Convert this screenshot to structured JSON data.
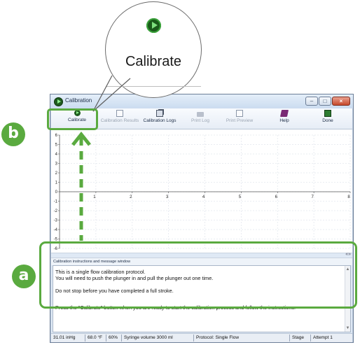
{
  "window": {
    "title": "Calibration",
    "controls": [
      "minimize",
      "maximize",
      "close"
    ]
  },
  "toolbar": {
    "buttons": [
      {
        "label": "Calibrate",
        "icon": "play-circle-icon",
        "enabled": true
      },
      {
        "label": "Calibration Results",
        "icon": "document-icon",
        "enabled": false
      },
      {
        "label": "Calibration Logs",
        "icon": "documents-icon",
        "enabled": true
      },
      {
        "label": "Print Log",
        "icon": "printer-icon",
        "enabled": false
      },
      {
        "label": "Print Preview",
        "icon": "print-preview-icon",
        "enabled": false
      },
      {
        "label": "Help",
        "icon": "help-book-icon",
        "enabled": true
      },
      {
        "label": "Done",
        "icon": "done-icon",
        "enabled": true
      }
    ]
  },
  "chart_data": {
    "type": "line",
    "x_ticks": [
      "1",
      "2",
      "3",
      "4",
      "5",
      "6",
      "7",
      "8"
    ],
    "y_ticks": [
      "6",
      "5",
      "4",
      "3",
      "2",
      "1",
      "0",
      "-1",
      "-2",
      "-3",
      "-4",
      "-5",
      "-6"
    ],
    "xlim": [
      0,
      8
    ],
    "ylim": [
      -6,
      6
    ],
    "grid": true,
    "series": []
  },
  "message_window": {
    "header": "Calibration instructions and message window",
    "lines": [
      "This is a single flow calibration protocol.",
      "You will need to push the plunger in and pull the plunger out one time.",
      "",
      "Do not stop before you have completed a full stroke.",
      "",
      "Press the \"Calibrate\" button when you are ready to start the calibration process and follow the instructions."
    ]
  },
  "status_bar": {
    "pressure": "31.01 inHg",
    "temperature": "68.0 °F",
    "humidity": "60%",
    "syringe": "Syringe volume 3000 ml",
    "protocol": "Protocol: Single Flow",
    "stage": "Stage",
    "attempt": "Attempt 1"
  },
  "callouts": {
    "zoom_label": "Calibrate",
    "badge_a": "a",
    "badge_b": "b",
    "accent_color": "#5aaa3f"
  }
}
